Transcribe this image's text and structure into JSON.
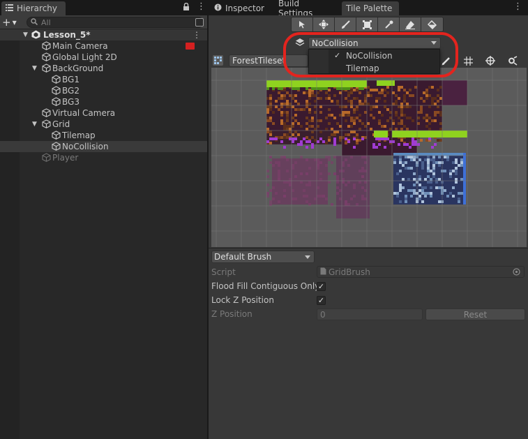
{
  "hierarchy": {
    "tab_label": "Hierarchy",
    "search_placeholder": "All",
    "add_label": "+",
    "tree": [
      {
        "label": "Lesson_5*"
      },
      {
        "label": "Main Camera"
      },
      {
        "label": "Global Light 2D"
      },
      {
        "label": "BackGround"
      },
      {
        "label": "BG1"
      },
      {
        "label": "BG2"
      },
      {
        "label": "BG3"
      },
      {
        "label": "Virtual Camera"
      },
      {
        "label": "Grid"
      },
      {
        "label": "Tilemap"
      },
      {
        "label": "NoCollision"
      },
      {
        "label": "Player"
      }
    ]
  },
  "right_tabs": {
    "inspector": "Inspector",
    "build_settings": "Build Settings",
    "tile_palette": "Tile Palette"
  },
  "tile_palette": {
    "active_tilemap": "NoCollision",
    "tilemap_options": [
      "NoCollision",
      "Tilemap"
    ],
    "selected_option": "NoCollision",
    "palette_name": "ForestTileset",
    "tools": [
      "select-tool",
      "move-tool",
      "paint-brush-tool",
      "box-fill-tool",
      "picker-tool",
      "eraser-tool",
      "fill-tool"
    ]
  },
  "brush": {
    "selected": "Default Brush",
    "script_label": "Script",
    "script_value": "GridBrush",
    "flood_fill_label": "Flood Fill Contiguous Only",
    "flood_fill_checked": true,
    "lock_z_label": "Lock Z Position",
    "lock_z_checked": true,
    "z_position_label": "Z Position",
    "z_position_value": "0",
    "reset_label": "Reset"
  },
  "colors": {
    "accent_highlight": "#e3241e",
    "grass": "#8fd21f",
    "dirt": "#5a2d1c",
    "purple": "#a03cd2",
    "stone_blue": "#5a8bc0"
  }
}
